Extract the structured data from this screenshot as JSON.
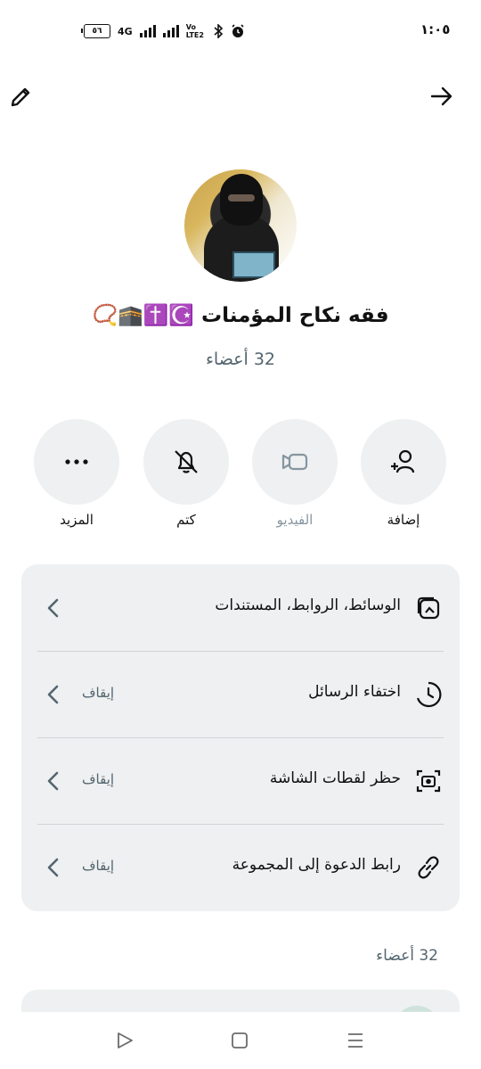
{
  "status_bar": {
    "time": "١:٠٥",
    "battery": "٥٦",
    "network": "4G",
    "volte": "Vo LTE2"
  },
  "group": {
    "name": "فقه نكاح المؤمنات ☪️✝️🕋📿",
    "members_count": "32 أعضاء"
  },
  "actions": [
    {
      "label": "إضافة",
      "icon": "add-person-icon"
    },
    {
      "label": "الفيديو",
      "icon": "video-icon"
    },
    {
      "label": "كتم",
      "icon": "mute-bell-icon"
    },
    {
      "label": "المزيد",
      "icon": "more-dots-icon"
    }
  ],
  "settings": [
    {
      "label": "الوسائط، الروابط، المستندات",
      "value": "",
      "icon": "media-icon"
    },
    {
      "label": "اختفاء الرسائل",
      "value": "إيقاف",
      "icon": "timer-icon"
    },
    {
      "label": "حظر لقطات الشاشة",
      "value": "إيقاف",
      "icon": "screenshot-icon"
    },
    {
      "label": "رابط الدعوة إلى المجموعة",
      "value": "إيقاف",
      "icon": "link-icon"
    }
  ],
  "members_section": {
    "label": "32 أعضاء"
  },
  "colors": {
    "background": "#ffffff",
    "card": "#eef0f1",
    "secondary_text": "#54656f",
    "disabled_text": "#8696a0"
  }
}
